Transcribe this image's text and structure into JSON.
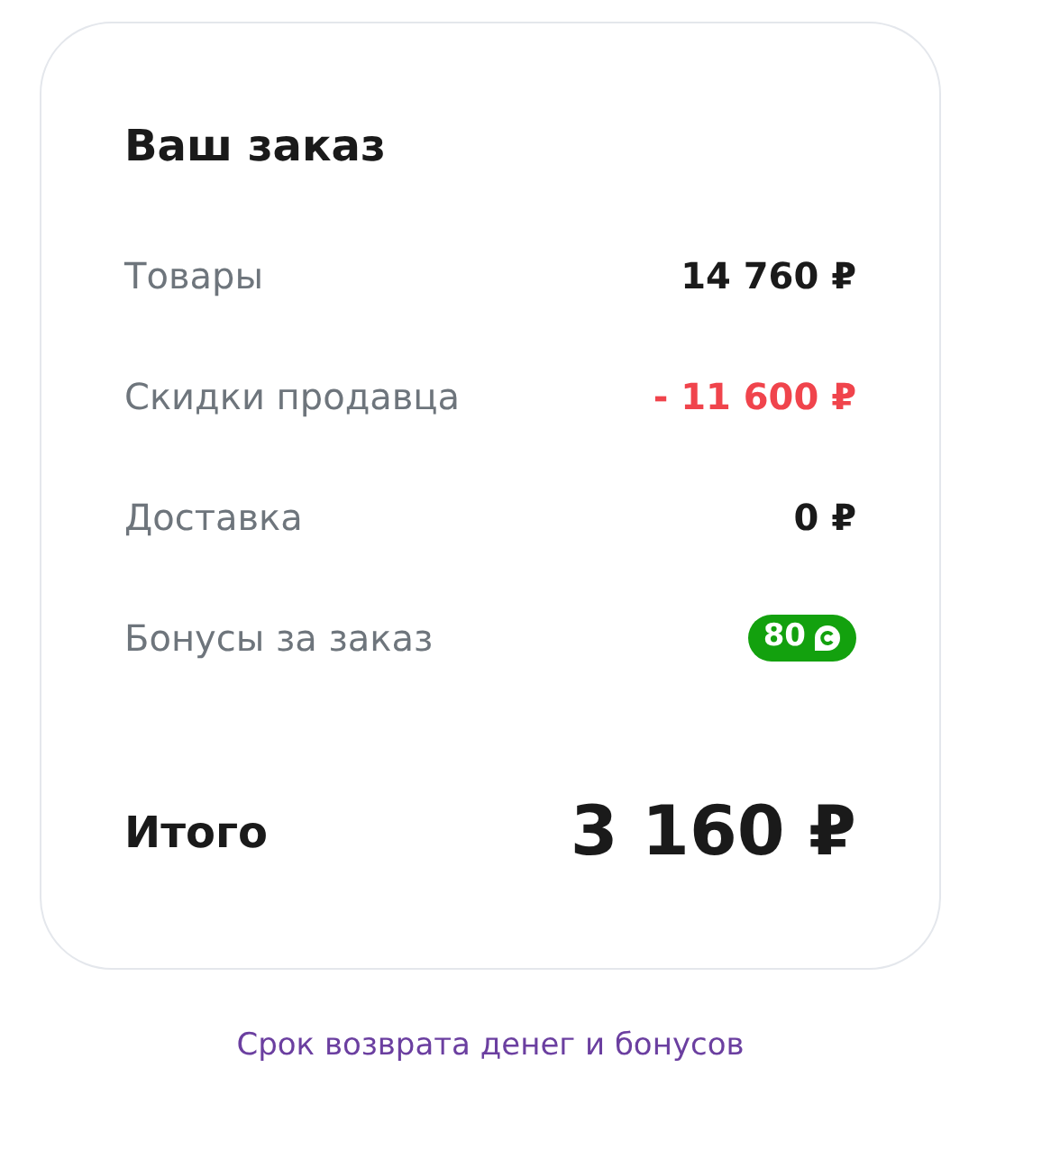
{
  "title": "Ваш заказ",
  "rows": [
    {
      "kind": "amount",
      "label": "Товары",
      "value": "14 760 ₽"
    },
    {
      "kind": "discount",
      "label": "Скидки продавца",
      "value": "- 11 600 ₽"
    },
    {
      "kind": "amount",
      "label": "Доставка",
      "value": "0 ₽"
    },
    {
      "kind": "bonus",
      "label": "Бонусы за заказ",
      "value": "80"
    }
  ],
  "total": {
    "label": "Итого",
    "value": "3 160 ₽"
  },
  "link": "Срок возврата денег и бонусов"
}
